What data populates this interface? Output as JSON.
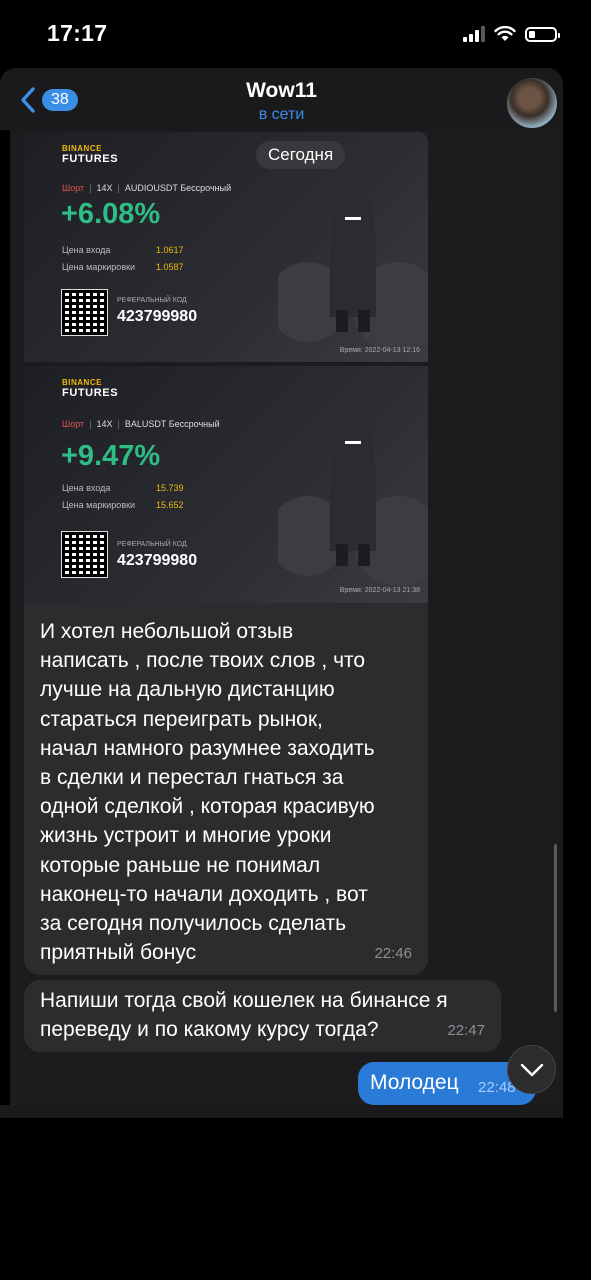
{
  "status_bar": {
    "time": "17:17"
  },
  "header": {
    "back_badge": "38",
    "title": "Wow11",
    "subtitle": "в сети"
  },
  "chat": {
    "date_chip": "Сегодня",
    "cards": [
      {
        "logo_small": "BINANCE",
        "logo_large": "FUTURES",
        "side": "Шорт",
        "leverage": "14X",
        "pair": "AUDIOUSDT Бессрочный",
        "pnl": "+6.08%",
        "entry_label": "Цена входа",
        "entry_value": "1.0617",
        "mark_label": "Цена маркировки",
        "mark_value": "1.0587",
        "ref_label": "РЕФЕРАЛЬНЫЙ КОД",
        "ref_code": "423799980",
        "time": "Время: 2022-04-13 12:16"
      },
      {
        "logo_small": "BINANCE",
        "logo_large": "FUTURES",
        "side": "Шорт",
        "leverage": "14X",
        "pair": "BALUSDT Бессрочный",
        "pnl": "+9.47%",
        "entry_label": "Цена входа",
        "entry_value": "15.739",
        "mark_label": "Цена маркировки",
        "mark_value": "15.652",
        "ref_label": "РЕФЕРАЛЬНЫЙ КОД",
        "ref_code": "423799980",
        "time": "Время: 2022-04-13 21:38"
      }
    ],
    "messages": [
      {
        "text": "И хотел небольшой отзыв\nнаписать , после твоих слов , что\nлучше на дальную дистанцию\nстараться переиграть рынок,\nначал намного разумнее заходить\nв сделки и перестал гнаться за\nодной сделкой , которая красивую\nжизнь устроит и многие уроки\nкоторые раньше не понимал\nнаконец-то начали доходить , вот\nза сегодня получилось сделать\nприятный бонус",
        "time": "22:46"
      },
      {
        "text": "Напиши тогда свой кошелек на бинансе я\nпереведу и по какому курсу тогда?",
        "time": "22:47"
      }
    ],
    "outgoing": {
      "text": "Молодец",
      "time": "22:48"
    }
  },
  "colors": {
    "accent": "#3a8ee6",
    "profit": "#2ebd85",
    "short": "#e0524f",
    "binance": "#f0b90b"
  }
}
